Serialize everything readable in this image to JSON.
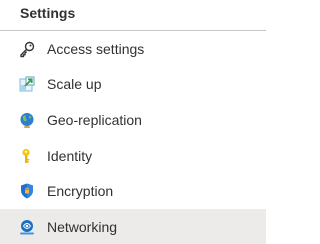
{
  "section": {
    "title": "Settings"
  },
  "items": [
    {
      "label": "Access settings",
      "icon": "key-icon",
      "selected": false
    },
    {
      "label": "Scale up",
      "icon": "scale-up-icon",
      "selected": false
    },
    {
      "label": "Geo-replication",
      "icon": "globe-icon",
      "selected": false
    },
    {
      "label": "Identity",
      "icon": "identity-key-icon",
      "selected": false
    },
    {
      "label": "Encryption",
      "icon": "shield-icon",
      "selected": false
    },
    {
      "label": "Networking",
      "icon": "networking-icon",
      "selected": true
    }
  ],
  "colors": {
    "text": "#323130",
    "divider": "#c8c6c4",
    "selected_bg": "#edebe9"
  }
}
